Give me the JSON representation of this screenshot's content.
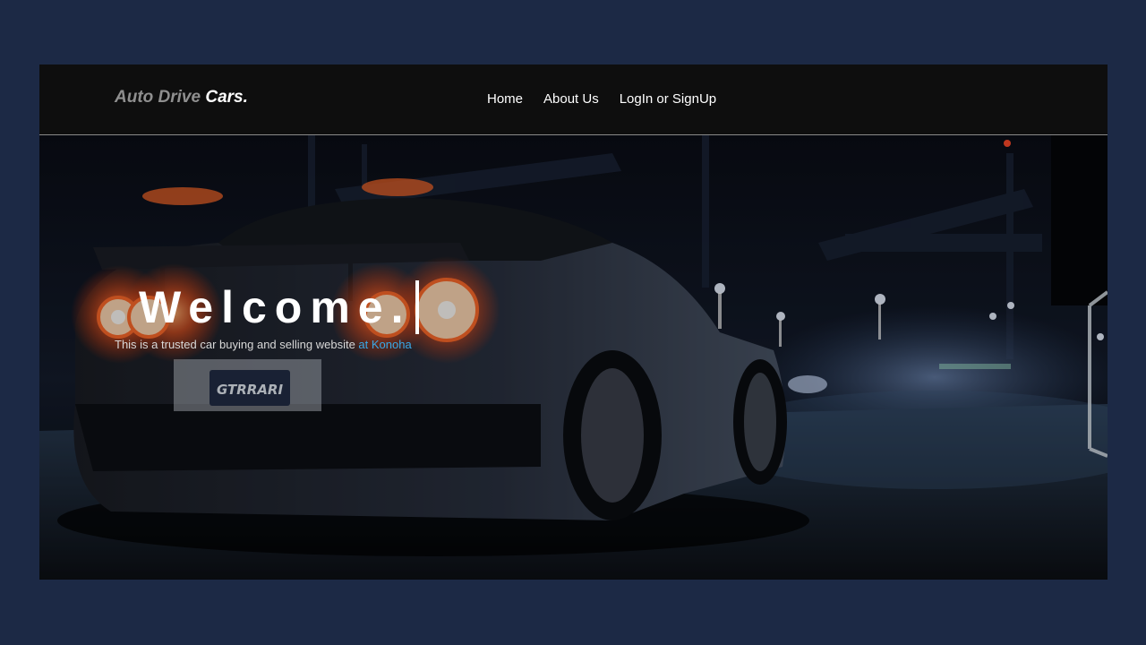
{
  "navbar": {
    "brand_part1": "Auto Drive",
    "brand_part2": "Cars.",
    "links": [
      {
        "label": "Home"
      },
      {
        "label": "About Us"
      },
      {
        "label": "LogIn or SignUp"
      }
    ]
  },
  "hero": {
    "title": "Welcome.",
    "subtitle_main": "This is a trusted car buying and selling website",
    "subtitle_highlight": " at Konoha",
    "background_image": "night-sports-car-rear-view",
    "plate_text": "GTRRARI"
  },
  "colors": {
    "page_background": "#1c2945",
    "navbar_background": "#0e0e0e",
    "highlight": "#39a9e8",
    "taillight": "#ff5a1f"
  }
}
